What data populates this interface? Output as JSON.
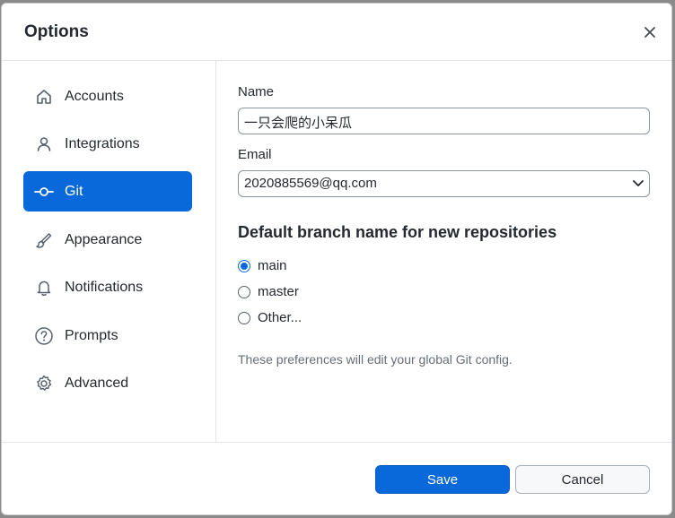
{
  "dialog": {
    "title": "Options",
    "close_icon": "close-icon"
  },
  "sidebar": {
    "items": [
      {
        "label": "Accounts",
        "icon": "home-icon",
        "active": false
      },
      {
        "label": "Integrations",
        "icon": "person-icon",
        "active": false
      },
      {
        "label": "Git",
        "icon": "git-commit-icon",
        "active": true
      },
      {
        "label": "Appearance",
        "icon": "paintbrush-icon",
        "active": false
      },
      {
        "label": "Notifications",
        "icon": "bell-icon",
        "active": false
      },
      {
        "label": "Prompts",
        "icon": "question-icon",
        "active": false
      },
      {
        "label": "Advanced",
        "icon": "gear-icon",
        "active": false
      }
    ]
  },
  "form": {
    "name_label": "Name",
    "name_value": "一只会爬的小呆瓜",
    "email_label": "Email",
    "email_value": "2020885569@qq.com",
    "branch_heading": "Default branch name for new repositories",
    "branch_options": [
      {
        "label": "main",
        "checked": true
      },
      {
        "label": "master",
        "checked": false
      },
      {
        "label": "Other...",
        "checked": false
      }
    ],
    "note": "These preferences will edit your global Git config."
  },
  "footer": {
    "save_label": "Save",
    "cancel_label": "Cancel"
  },
  "colors": {
    "accent": "#0969da",
    "text": "#24292f",
    "muted": "#656d76"
  }
}
